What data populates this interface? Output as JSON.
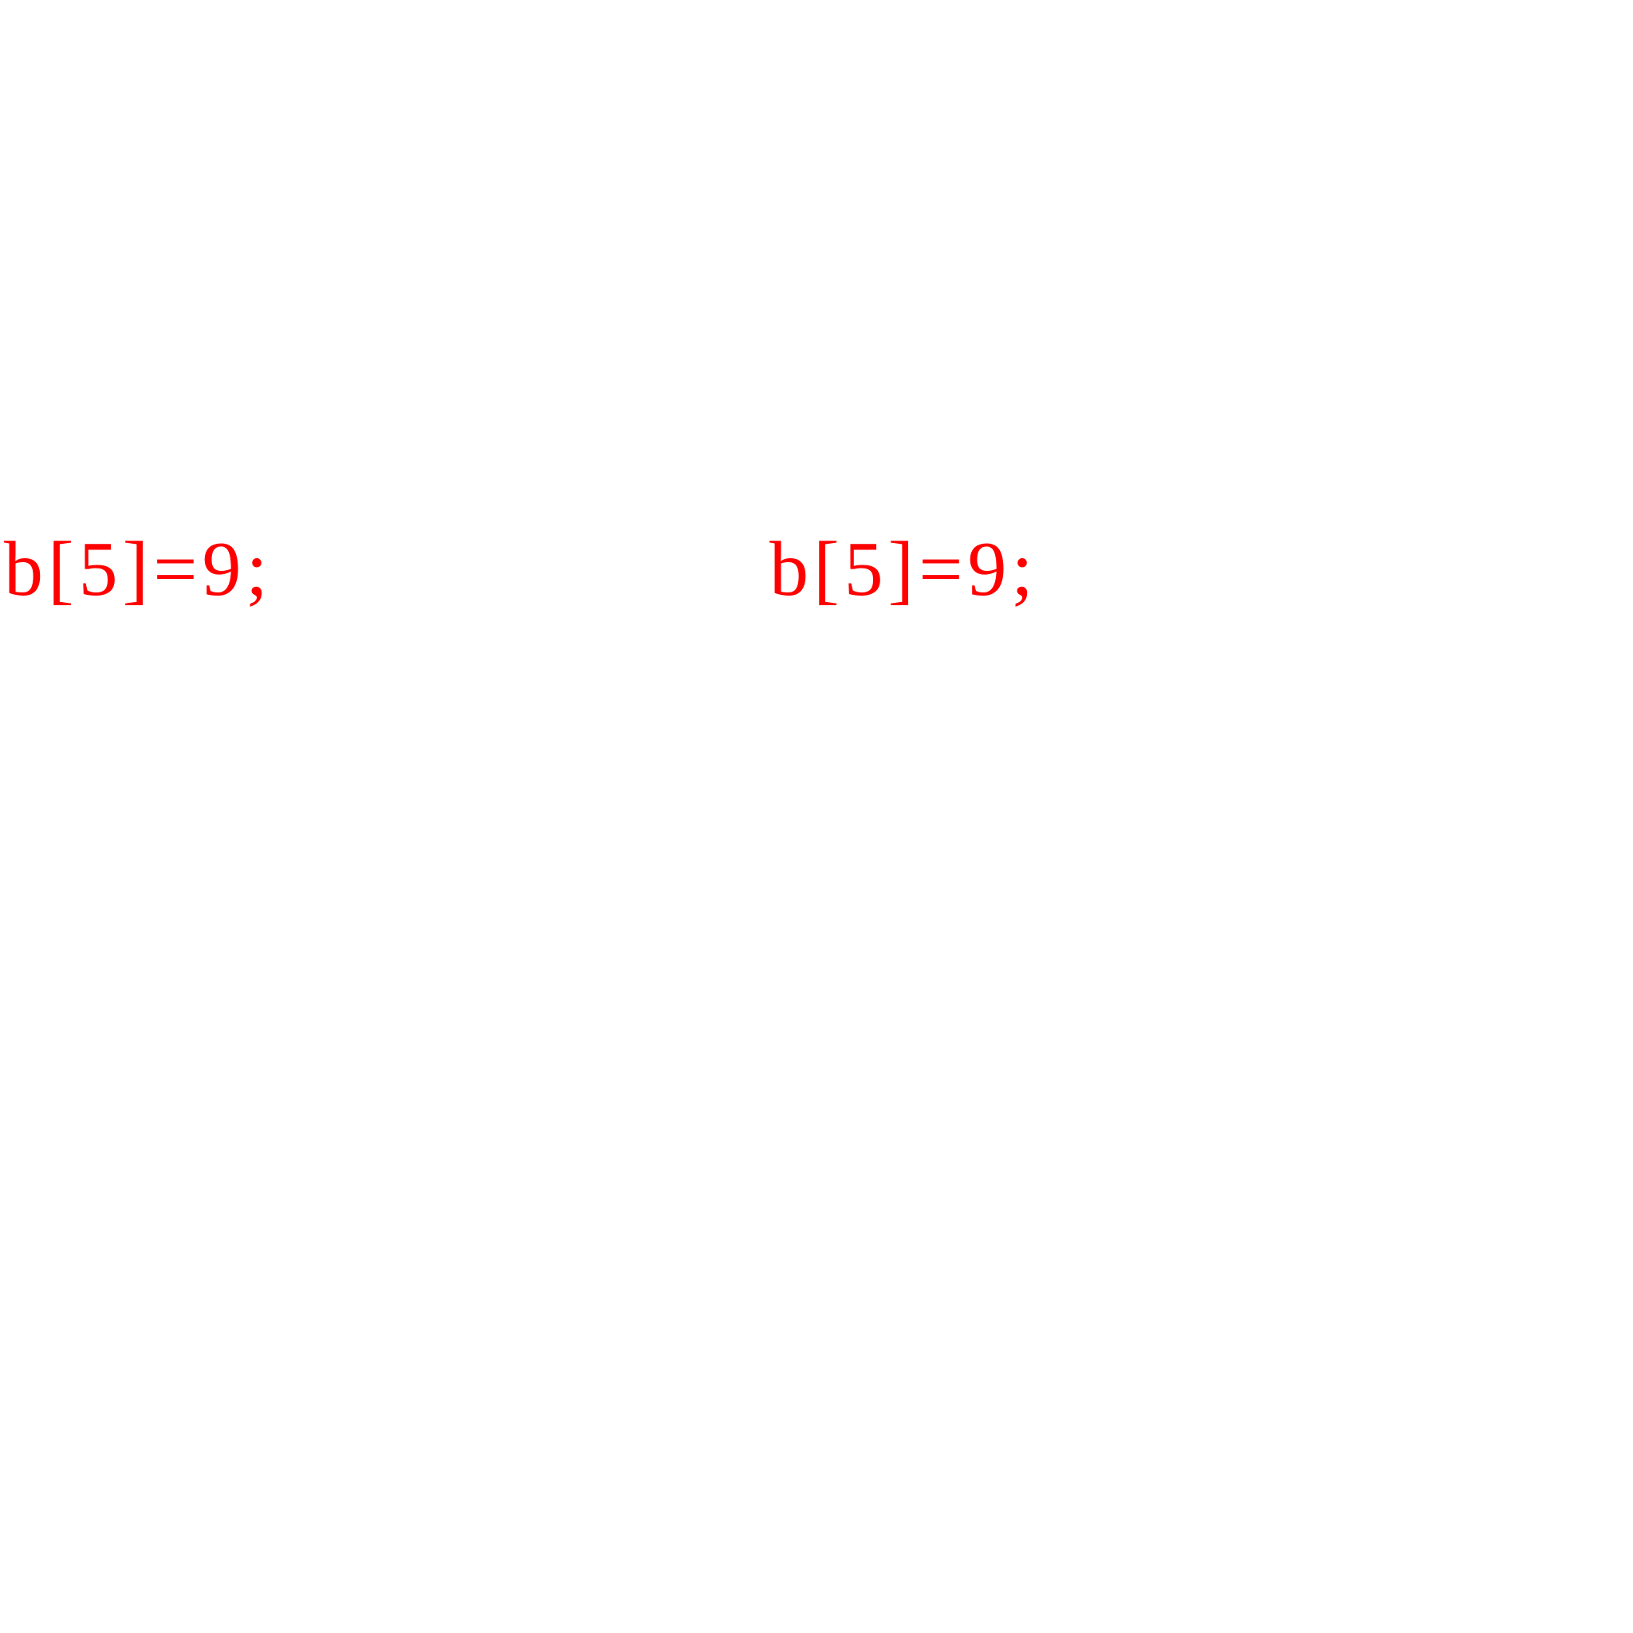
{
  "statements": [
    {
      "text": "b[5]=9;"
    },
    {
      "text": "b[5]=9;"
    }
  ],
  "colors": {
    "text": "#ff0000",
    "background": "#ffffff"
  }
}
